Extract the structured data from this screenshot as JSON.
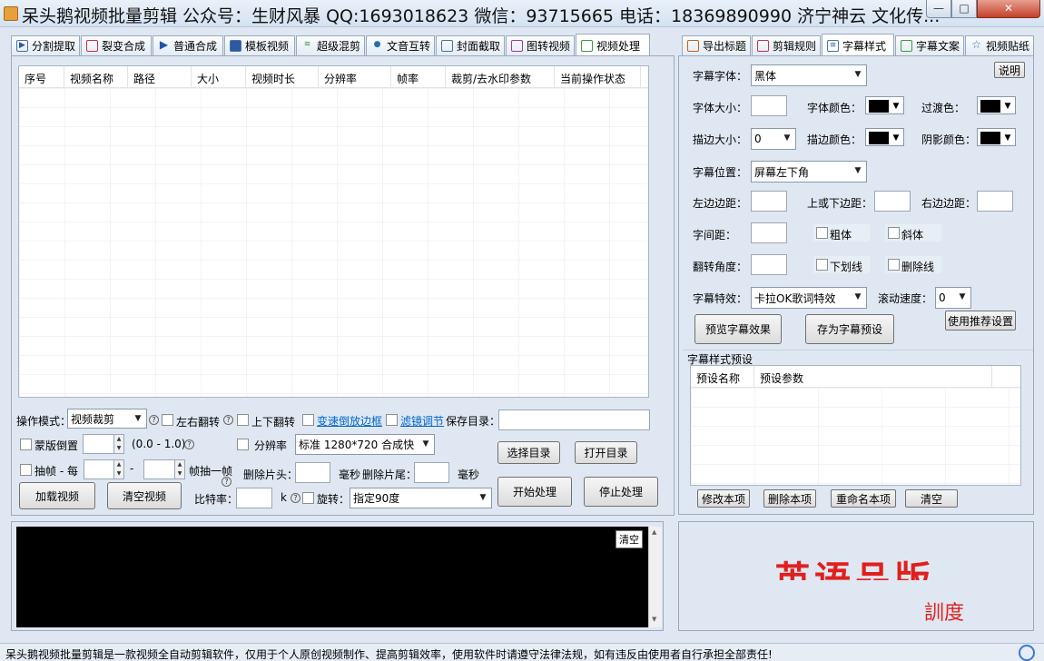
{
  "window": {
    "title": "呆头鹅视频批量剪辑 公众号：生财风暴 QQ:1693018623 微信：93715665 电话：18369890990 济宁神云 文化传..."
  },
  "left_tabs": [
    {
      "label": "分割提取",
      "icon": "split-icon"
    },
    {
      "label": "裂变合成",
      "icon": "fission-icon"
    },
    {
      "label": "普通合成",
      "icon": "play-icon"
    },
    {
      "label": "模板视频",
      "icon": "template-icon"
    },
    {
      "label": "超级混剪",
      "icon": "audio-wave-icon"
    },
    {
      "label": "文音互转",
      "icon": "microphone-icon"
    },
    {
      "label": "封面截取",
      "icon": "image-icon"
    },
    {
      "label": "图转视频",
      "icon": "picture-video-icon"
    },
    {
      "label": "视频处理",
      "icon": "video-process-icon"
    }
  ],
  "video_table": {
    "columns": [
      "序号",
      "视频名称",
      "路径",
      "大小",
      "视频时长",
      "分辨率",
      "帧率",
      "裁剪/去水印参数",
      "当前操作状态"
    ]
  },
  "controls": {
    "mode_label": "操作模式：",
    "mode_value": "视频裁剪",
    "flip_lr": "左右翻转",
    "flip_ud": "上下翻转",
    "speed_link": "变速倒放边框",
    "filter_link": "滤镜调节",
    "save_dir_label": "保存目录：",
    "mask_invert": "蒙版倒置",
    "mask_range": "(0.0 - 1.0)",
    "resolution_chk": "分辨率",
    "resolution_value": "标准 1280*720 合成快",
    "select_dir": "选择目录",
    "open_dir": "打开目录",
    "extract_frame": "抽帧 - 每",
    "dash": "-",
    "frame_extract_tail": "帧抽一帧",
    "delete_head": "删除片头：",
    "ms1": "毫秒",
    "delete_tail": "删除片尾：",
    "ms2": "毫秒",
    "add_video": "加载视频",
    "clear_video": "清空视频",
    "bitrate_label": "比特率：",
    "bitrate_unit": "k",
    "rotate_chk": "旋转：",
    "rotate_value": "指定90度",
    "start": "开始处理",
    "stop": "停止处理"
  },
  "console": {
    "clear": "清空"
  },
  "right_tabs": [
    {
      "label": "导出标题",
      "icon": "export-icon"
    },
    {
      "label": "剪辑规则",
      "icon": "rule-icon"
    },
    {
      "label": "字幕样式",
      "icon": "subtitle-icon"
    },
    {
      "label": "字幕文案",
      "icon": "edit-icon"
    },
    {
      "label": "视频贴纸",
      "icon": "star-icon"
    }
  ],
  "subtitle": {
    "help": "说明",
    "font_label": "字幕字体：",
    "font_value": "黑体",
    "size_label": "字体大小：",
    "color_label": "字体颜色：",
    "transition_label": "过渡色：",
    "stroke_size_label": "描边大小：",
    "stroke_size_value": "0",
    "stroke_color_label": "描边颜色：",
    "shadow_color_label": "阴影颜色：",
    "position_label": "字幕位置：",
    "position_value": "屏幕左下角",
    "left_margin": "左边边距：",
    "vert_margin": "上或下边距：",
    "right_margin": "右边边距：",
    "spacing": "字间距：",
    "bold": "粗体",
    "italic": "斜体",
    "rotate": "翻转角度：",
    "underline": "下划线",
    "strike": "删除线",
    "effect_label": "字幕特效：",
    "effect_value": "卡拉OK歌词特效",
    "scroll_label": "滚动速度：",
    "scroll_value": "0",
    "preview": "预览字幕效果",
    "save_preset": "存为字幕预设",
    "use_recommended": "使用推荐设置",
    "preset_title": "字幕样式预设",
    "preset_columns": [
      "预设名称",
      "预设参数"
    ],
    "modify": "修改本项",
    "delete": "删除本项",
    "rename": "重命名本项",
    "clear": "清空"
  },
  "ad": {
    "text_top": "英语品版",
    "text_bottom": "訓度"
  },
  "status": "呆头鹅视频批量剪辑是一款视频全自动剪辑软件，仅用于个人原创视频制作、提高剪辑效率，使用软件时请遵守法律法规，如有违反由使用者自行承担全部责任!",
  "colors": {
    "accent": "#0066cc",
    "ad_red": "#e0201e"
  }
}
